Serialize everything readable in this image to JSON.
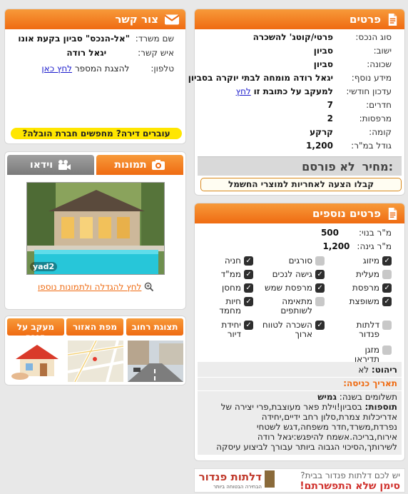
{
  "details": {
    "title": "פרטים",
    "rows": [
      {
        "label": "סוג הנכס:",
        "value": "פרטי/קוטג' להשכרה"
      },
      {
        "label": "ישוב:",
        "value": "סביון"
      },
      {
        "label": "שכונה:",
        "value": "סביון"
      },
      {
        "label": "מידע נוסף:",
        "value": "יגאל רודה מומחה לבתי יוקרה בסביון"
      },
      {
        "label": "עדכון חודשי:",
        "value": "למעקב על כתובת זו",
        "link": "לחץ"
      },
      {
        "label": "חדרים:",
        "value": "7"
      },
      {
        "label": "מרפסות:",
        "value": "2"
      },
      {
        "label": "קומה:",
        "value": "קרקע"
      },
      {
        "label": "גודל במ\"ר:",
        "value": "1,200"
      }
    ],
    "price_label": "מחיר:",
    "price_value": "לא פורסם",
    "offer": "קבלו הצעה לאחריות למוצרי החשמל"
  },
  "contact": {
    "title": "צור קשר",
    "office_label": "שם משרד:",
    "office_value": "\"אל-הנכס\" סביון בקעת אונו",
    "person_label": "איש קשר:",
    "person_value": "יגאל רודה",
    "phone_label": "טלפון:",
    "phone_text": "להצגת המספר",
    "phone_link": "לחץ כאן",
    "moving_banner": "עוברים דירה? מחפשים חברת הובלה?"
  },
  "media": {
    "tab_photos": "תמונות",
    "tab_video": "וידאו",
    "watermark": "yad2",
    "enlarge_link": "לחץ להגדלה ולתמונות נוספו"
  },
  "maps": {
    "street_view": "תצוגת רחוב",
    "area_map": "מפת האזור",
    "price_tracker": "מעקב על הנכס"
  },
  "extra": {
    "title": "פרטים נוספים",
    "built_label": "מ\"ר בנוי:",
    "built_value": "500",
    "garden_label": "מ\"ר גינה:",
    "garden_value": "1,200",
    "features": [
      {
        "label": "מיזוג",
        "on": true
      },
      {
        "label": "סורגים",
        "on": false
      },
      {
        "label": "חניה",
        "on": true
      },
      {
        "label": "מעלית",
        "on": false
      },
      {
        "label": "גישה לנכים",
        "on": true
      },
      {
        "label": "ממ\"ד",
        "on": true
      },
      {
        "label": "מרפסת",
        "on": true
      },
      {
        "label": "מרפסת שמש",
        "on": true
      },
      {
        "label": "מחסן",
        "on": true
      },
      {
        "label": "משופצת",
        "on": true
      },
      {
        "label": "מתאימה לשותפים",
        "on": false
      },
      {
        "label": "חיות מחמד",
        "on": true
      },
      {
        "label": "דלתות פנדור",
        "on": false
      },
      {
        "label": "השכרה לטווח ארוך",
        "on": true
      },
      {
        "label": "יחידת דיור",
        "on": true
      },
      {
        "label": "מזגן תדיראן",
        "on": false
      }
    ],
    "furnish_label": "ריהוט:",
    "furnish_value": "לא",
    "entry_label": "תאריך כניסה:",
    "payments_label": "תשלומים בשנה:",
    "payments_value": "גמיש",
    "additions_label": "תוספות:",
    "additions_text": "בסביון!וילת פאר מעוצבת,פרי יצירה של אדריכלות צמרת,סלון רחב ידיים,יחידה נפרדת,משרד,חדר משפחה,דגש לשטחי אירוח,בריכה.אשמח להיפגש:יגאל רודה לשירותך,הסיכוי הגבוה ביותר עבורך לביצוע עיסקה"
  },
  "ad": {
    "line1": "יש לכם דלתות פנדור בבית?",
    "line2": "סימן שלא התפשרתם!",
    "brand": "דלתות פנדור",
    "brand_sub": "הבחירה הבטוחה ביותר"
  },
  "colors": {
    "accent": "#ef6b12",
    "banner": "#ffe600",
    "price_bg": "#d9d9d9"
  }
}
